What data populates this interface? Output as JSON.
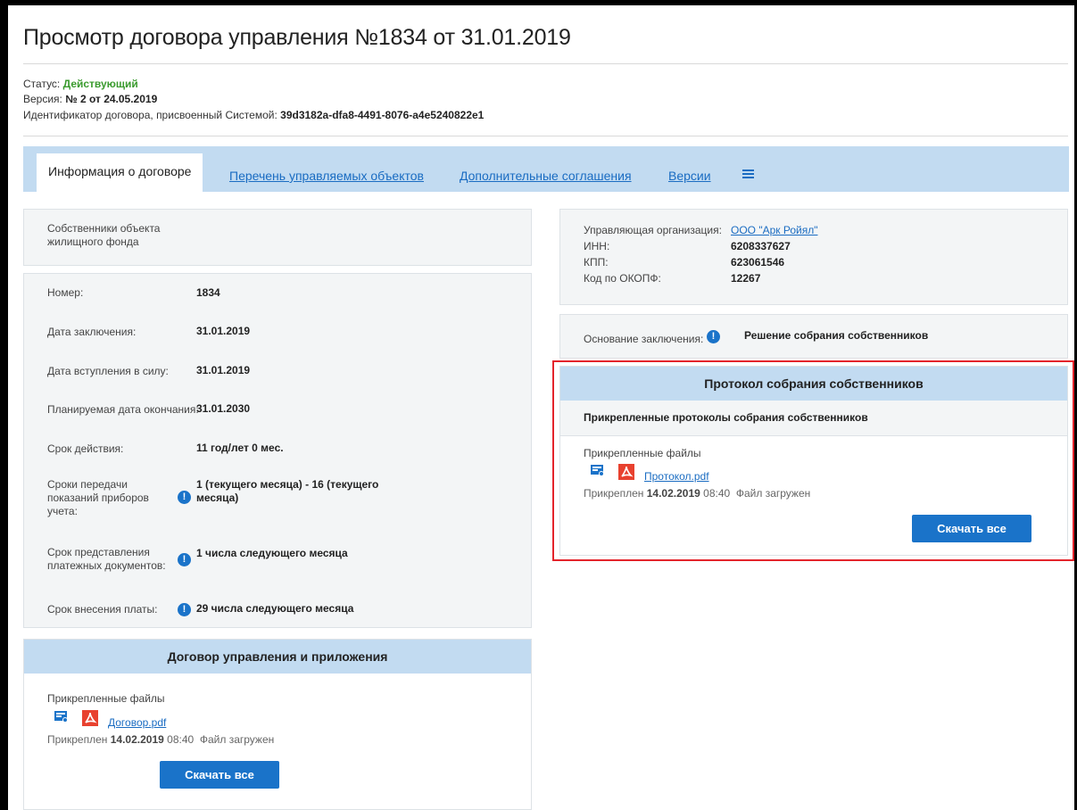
{
  "page": {
    "title": "Просмотр договора управления №1834 от 31.01.2019",
    "status_label": "Статус:",
    "status_value": "Действующий",
    "version_label": "Версия:",
    "version_value": "№ 2 от 24.05.2019",
    "id_label": "Идентификатор договора, присвоенный Системой:",
    "id_value": "39d3182a-dfa8-4491-8076-a4e5240822e1"
  },
  "tabs": [
    {
      "label": "Информация о договоре"
    },
    {
      "label": "Перечень управляемых объектов"
    },
    {
      "label": "Дополнительные соглашения"
    },
    {
      "label": "Версии"
    }
  ],
  "left": {
    "owners_label": "Собственники объекта жилищного фонда",
    "rows": [
      {
        "label": "Номер:",
        "value": "1834"
      },
      {
        "label": "Дата заключения:",
        "value": "31.01.2019"
      },
      {
        "label": "Дата вступления в силу:",
        "value": "31.01.2019"
      },
      {
        "label": "Планируемая дата окончания:",
        "value": "31.01.2030"
      },
      {
        "label": "Срок действия:",
        "value": "11 год/лет 0 мес."
      },
      {
        "label": "Сроки передачи показаний приборов учета:",
        "value": "1 (текущего месяца) - 16 (текущего месяца)"
      },
      {
        "label": "Срок представления платежных документов:",
        "value": "1 числа следующего месяца"
      },
      {
        "label": "Срок внесения платы:",
        "value": "29 числа следующего месяца"
      }
    ],
    "contract_card": {
      "title": "Договор управления и приложения",
      "files_label": "Прикрепленные файлы",
      "file_name": "Договор.pdf",
      "attached_prefix": "Прикреплен",
      "attached_date": "14.02.2019",
      "attached_time": "08:40",
      "file_status": "Файл загружен",
      "download_label": "Скачать все"
    }
  },
  "right": {
    "org_label": "Управляющая организация:",
    "org_value": "ООО \"Арк Ройял\"",
    "inn_label": "ИНН:",
    "inn_value": "6208337627",
    "kpp_label": "КПП:",
    "kpp_value": "623061546",
    "okopf_label": "Код по ОКОПФ:",
    "okopf_value": "12267",
    "basis_label": "Основание заключения:",
    "basis_value": "Решение собрания собственников",
    "protocol_card": {
      "title": "Протокол собрания собственников",
      "subtitle": "Прикрепленные протоколы собрания собственников",
      "files_label": "Прикрепленные файлы",
      "file_name": "Протокол.pdf",
      "attached_prefix": "Прикреплен",
      "attached_date": "14.02.2019",
      "attached_time": "08:40",
      "file_status": "Файл загружен",
      "download_label": "Скачать все"
    }
  },
  "colors": {
    "accent": "#1a73c9",
    "status_green": "#3a9b2e",
    "tab_bg": "#c2dbf1",
    "highlight_red": "#e3242b"
  },
  "icons": [
    "list-icon",
    "info-icon",
    "signature-icon",
    "pdf-icon"
  ]
}
